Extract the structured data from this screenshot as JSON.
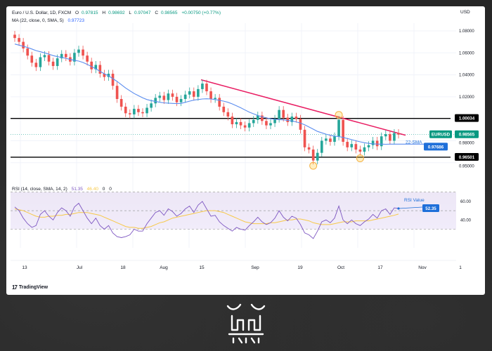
{
  "chart_data": {
    "type": "candlestick",
    "symbol_title": "Euro / U.S. Dollar, 1D, FXCM",
    "ohlc": {
      "o_label": "O",
      "o": "0.97815",
      "h_label": "H",
      "h": "0.98692",
      "l_label": "L",
      "l": "0.97047",
      "c_label": "C",
      "c": "0.98565",
      "change": "+0.00750 (+0.77%)"
    },
    "ma_label": "MA (22, close, 0, SMA, 5)",
    "ma_value": "0.97723",
    "currency": "USD",
    "y_ticks": [
      "1.08000",
      "1.06000",
      "1.04000",
      "1.02000",
      "0.98000",
      "0.95000"
    ],
    "x_ticks": [
      "13",
      "Jul",
      "18",
      "Aug",
      "15",
      "Sep",
      "19",
      "Oct",
      "17",
      "Nov",
      "1"
    ],
    "levels": [
      {
        "label": "1.00034",
        "value": 1.00034
      },
      {
        "label": "0.96501",
        "value": 0.96501
      }
    ],
    "symbol_tag": "EURUSD",
    "last_price": "0.98565",
    "sma_label": "22-SMA",
    "sma_price": "0.97686",
    "rsi_label": "RSI (14, close, SMA, 14, 2)",
    "rsi_values_text": [
      "51.35",
      "46.40",
      "0",
      "0"
    ],
    "rsi_ticks": [
      "60.00",
      "40.00"
    ],
    "rsi_annotation": "RSI Value",
    "rsi_last": "52.35",
    "closes": [
      1.0735,
      1.07,
      1.064,
      1.0575,
      1.051,
      1.047,
      1.056,
      1.058,
      1.052,
      1.048,
      1.055,
      1.059,
      1.056,
      1.052,
      1.06,
      1.063,
      1.0575,
      1.052,
      1.045,
      1.049,
      1.041,
      1.038,
      1.041,
      1.03,
      1.018,
      1.011,
      1.005,
      1.004,
      1.009,
      1.006,
      1.005,
      1.01,
      1.014,
      1.019,
      1.021,
      1.017,
      1.023,
      1.02,
      1.015,
      1.018,
      1.022,
      1.025,
      1.02,
      1.027,
      1.032,
      1.025,
      1.018,
      1.019,
      1.011,
      1.006,
      1.002,
      0.995,
      0.997,
      0.994,
      0.992,
      0.996,
      0.999,
      1.003,
      0.998,
      0.994,
      0.996,
      1.0,
      1.008,
      1.001,
      0.997,
      1.002,
      1.0,
      0.99,
      0.974,
      0.972,
      0.962,
      0.969,
      0.98,
      0.982,
      0.979,
      0.984,
      0.999,
      0.979,
      0.974,
      0.977,
      0.972,
      0.97,
      0.974,
      0.976,
      0.98,
      0.975,
      0.984,
      0.986,
      0.98,
      0.987,
      0.9856
    ],
    "sma": [
      1.068,
      1.067,
      1.066,
      1.0648,
      1.0635,
      1.062,
      1.061,
      1.06,
      1.0588,
      1.0575,
      1.0565,
      1.0558,
      1.055,
      1.054,
      1.0532,
      1.0525,
      1.0512,
      1.0495,
      1.0475,
      1.0455,
      1.0432,
      1.041,
      1.039,
      1.0365,
      1.034,
      1.031,
      1.028,
      1.0255,
      1.023,
      1.021,
      1.019,
      1.0175,
      1.0165,
      1.0158,
      1.015,
      1.0145,
      1.0142,
      1.014,
      1.0138,
      1.014,
      1.015,
      1.016,
      1.017,
      1.0175,
      1.018,
      1.0182,
      1.018,
      1.0175,
      1.0168,
      1.016,
      1.015,
      1.0135,
      1.0118,
      1.01,
      1.008,
      1.006,
      1.0045,
      1.003,
      1.0018,
      1.0008,
      1.0,
      0.9995,
      0.9992,
      0.999,
      0.9985,
      0.998,
      0.9972,
      0.996,
      0.9945,
      0.9925,
      0.9905,
      0.9885,
      0.9872,
      0.986,
      0.985,
      0.9842,
      0.9838,
      0.983,
      0.982,
      0.981,
      0.98,
      0.979,
      0.9782,
      0.9776,
      0.9772,
      0.977,
      0.9769,
      0.9768,
      0.9769,
      0.9769,
      0.9769
    ],
    "rsi": [
      54,
      50,
      42,
      36,
      32,
      34,
      46,
      50,
      44,
      40,
      48,
      53,
      50,
      44,
      54,
      58,
      50,
      42,
      36,
      42,
      34,
      30,
      34,
      26,
      22,
      21,
      22,
      24,
      30,
      28,
      28,
      36,
      42,
      48,
      50,
      45,
      52,
      49,
      44,
      47,
      52,
      55,
      48,
      56,
      60,
      52,
      44,
      45,
      38,
      34,
      31,
      28,
      32,
      30,
      29,
      34,
      38,
      43,
      38,
      35,
      37,
      42,
      50,
      43,
      39,
      44,
      42,
      35,
      26,
      24,
      20,
      28,
      38,
      40,
      37,
      42,
      55,
      40,
      36,
      40,
      36,
      34,
      38,
      41,
      46,
      42,
      50,
      52,
      46,
      53,
      52.35
    ],
    "rsi_sma": [
      52,
      51,
      50,
      48,
      46,
      44,
      43,
      43,
      44,
      44,
      45,
      45,
      46,
      46,
      47,
      48,
      48,
      48,
      47,
      46,
      45,
      43,
      41,
      39,
      37,
      35,
      33,
      32,
      32,
      31,
      31,
      32,
      33,
      35,
      37,
      38,
      40,
      42,
      43,
      44,
      45,
      46,
      47,
      48,
      49,
      50,
      50,
      50,
      49,
      48,
      46,
      44,
      42,
      40,
      38,
      37,
      36,
      36,
      36,
      36,
      37,
      37,
      38,
      39,
      40,
      40,
      41,
      41,
      40,
      39,
      37,
      36,
      35,
      35,
      35,
      36,
      37,
      38,
      38,
      38,
      39,
      39,
      39,
      39,
      40,
      41,
      42,
      43,
      44,
      45,
      46.4
    ],
    "y_range": [
      0.949,
      1.087
    ],
    "rsi_range": [
      10,
      72
    ]
  }
}
